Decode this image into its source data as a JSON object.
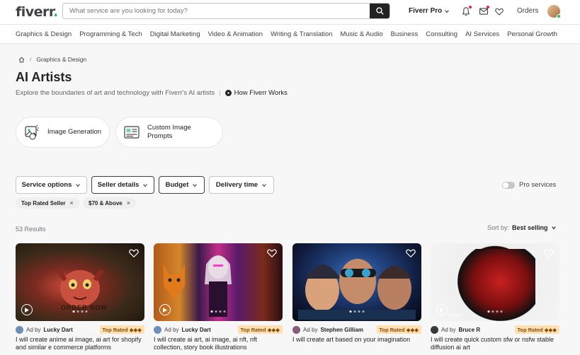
{
  "header": {
    "logo_text": "fiverr",
    "logo_dot": ".",
    "search_placeholder": "What service are you looking for today?",
    "fiverr_pro_label": "Fiverr Pro",
    "orders_label": "Orders"
  },
  "categories": [
    "Graphics & Design",
    "Programming & Tech",
    "Digital Marketing",
    "Video & Animation",
    "Writing & Translation",
    "Music & Audio",
    "Business",
    "Consulting",
    "AI Services",
    "Personal Growth"
  ],
  "breadcrumb": {
    "sep": "/",
    "current": "Graphics & Design"
  },
  "page": {
    "title": "AI Artists",
    "subtitle": "Explore the boundaries of art and technology with Fiverr's AI artists",
    "subtitle_sep": "|",
    "how_it_works": "How Fiverr Works"
  },
  "subcategories": [
    {
      "label": "Image Generation"
    },
    {
      "label_line1": "Custom Image",
      "label_line2": "Prompts"
    }
  ],
  "filters": {
    "service_options": "Service options",
    "seller_details": "Seller details",
    "budget": "Budget",
    "delivery_time": "Delivery time",
    "pro_services": "Pro services"
  },
  "chips": [
    {
      "label": "Top Rated Seller",
      "remove": "×"
    },
    {
      "label": "$70 & Above",
      "remove": "×"
    }
  ],
  "results": {
    "count_label": "53 Results",
    "sort_label": "Sort by:",
    "sort_value": "Best selling"
  },
  "gigs": [
    {
      "ad": "Ad by",
      "seller": "Lucky Dart",
      "badge": "Top Rated ◆◆◆",
      "title": "I will create anime ai image, ai art for shopify and similar e commerce platforms",
      "image_caption": "ORDER NOW",
      "avatar_color": "#6b8fb8"
    },
    {
      "ad": "Ad by",
      "seller": "Lucky Dart",
      "badge": "Top Rated ◆◆◆",
      "title": "I will create ai art, ai image, ai nft, nft collection, story book illustrations",
      "avatar_color": "#6b8fb8"
    },
    {
      "ad": "Ad by",
      "seller": "Stephen Gilliam",
      "badge": "Top Rated ◆◆◆",
      "title": "I will create art based on your imagination",
      "avatar_color": "#8a5a7a"
    },
    {
      "ad": "Ad by",
      "seller": "Bruce R",
      "badge": "Top Rated ◆◆◆",
      "title": "I will create quick custom sfw or nsfw stable diffusion ai art",
      "image_caption": "sovavi",
      "avatar_color": "#3a3a3a"
    }
  ],
  "colors": {
    "brand_green": "#1dbf73",
    "text_dark": "#222325",
    "badge_bg": "#ffe0b3"
  }
}
